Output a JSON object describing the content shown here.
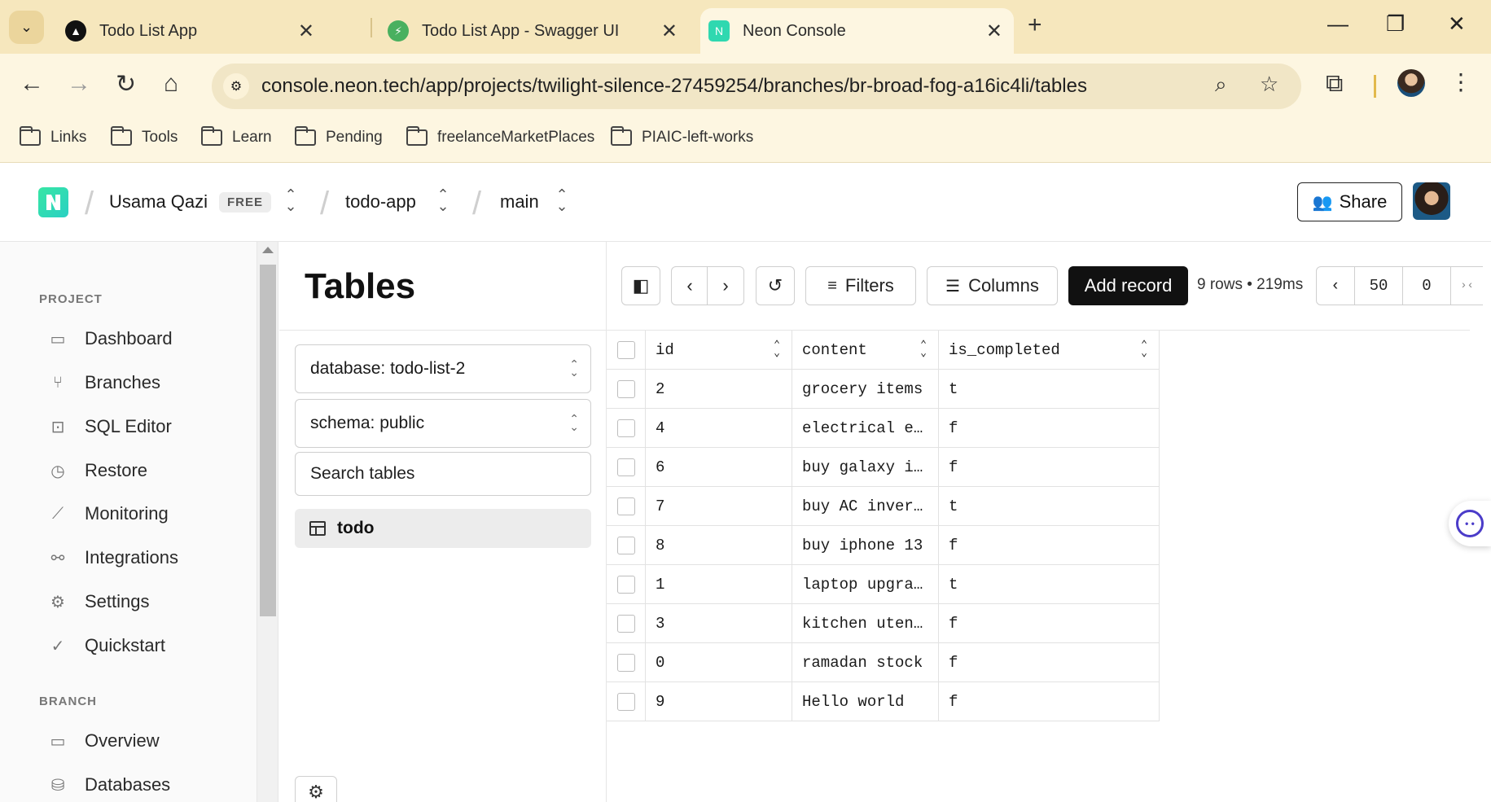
{
  "browser": {
    "tabs": [
      {
        "title": "Todo List App",
        "icon": "triangle-logo-icon",
        "active": false
      },
      {
        "title": "Todo List App - Swagger UI",
        "icon": "swagger-icon",
        "active": false
      },
      {
        "title": "Neon Console",
        "icon": "neon-icon",
        "active": true
      }
    ],
    "url": "console.neon.tech/app/projects/twilight-silence-27459254/branches/br-broad-fog-a16ic4li/tables",
    "bookmarks": [
      "Links",
      "Tools",
      "Learn",
      "Pending",
      "freelanceMarketPlaces",
      "PIAIC-left-works"
    ]
  },
  "header": {
    "org": "Usama Qazi",
    "plan_badge": "FREE",
    "project": "todo-app",
    "branch": "main",
    "share_label": "Share"
  },
  "sidebar": {
    "project_section": "PROJECT",
    "project_items": [
      {
        "label": "Dashboard",
        "icon": "dashboard-icon"
      },
      {
        "label": "Branches",
        "icon": "branches-icon"
      },
      {
        "label": "SQL Editor",
        "icon": "sql-editor-icon"
      },
      {
        "label": "Restore",
        "icon": "restore-icon"
      },
      {
        "label": "Monitoring",
        "icon": "monitoring-icon"
      },
      {
        "label": "Integrations",
        "icon": "integrations-icon"
      },
      {
        "label": "Settings",
        "icon": "settings-icon"
      },
      {
        "label": "Quickstart",
        "icon": "quickstart-icon"
      }
    ],
    "branch_section": "BRANCH",
    "branch_items": [
      {
        "label": "Overview",
        "icon": "overview-icon"
      },
      {
        "label": "Databases",
        "icon": "databases-icon"
      }
    ]
  },
  "tables_panel": {
    "title": "Tables",
    "database_select": "database: todo-list-2",
    "schema_select": "schema: public",
    "search_placeholder": "Search tables",
    "tables": [
      "todo"
    ]
  },
  "toolbar": {
    "filters_label": "Filters",
    "columns_label": "Columns",
    "add_record_label": "Add record",
    "row_info": "9 rows • 219ms",
    "page_size": "50",
    "offset": "0"
  },
  "grid": {
    "columns": [
      "id",
      "content",
      "is_completed"
    ],
    "rows": [
      [
        "2",
        "grocery items",
        "t"
      ],
      [
        "4",
        "electrical e…",
        "f"
      ],
      [
        "6",
        "buy galaxy i…",
        "f"
      ],
      [
        "7",
        "buy AC inver…",
        "t"
      ],
      [
        "8",
        "buy iphone 13",
        "f"
      ],
      [
        "1",
        "laptop upgra…",
        "t"
      ],
      [
        "3",
        "kitchen uten…",
        "f"
      ],
      [
        "0",
        "ramadan stock",
        "f"
      ],
      [
        "9",
        "Hello world",
        "f"
      ]
    ]
  }
}
